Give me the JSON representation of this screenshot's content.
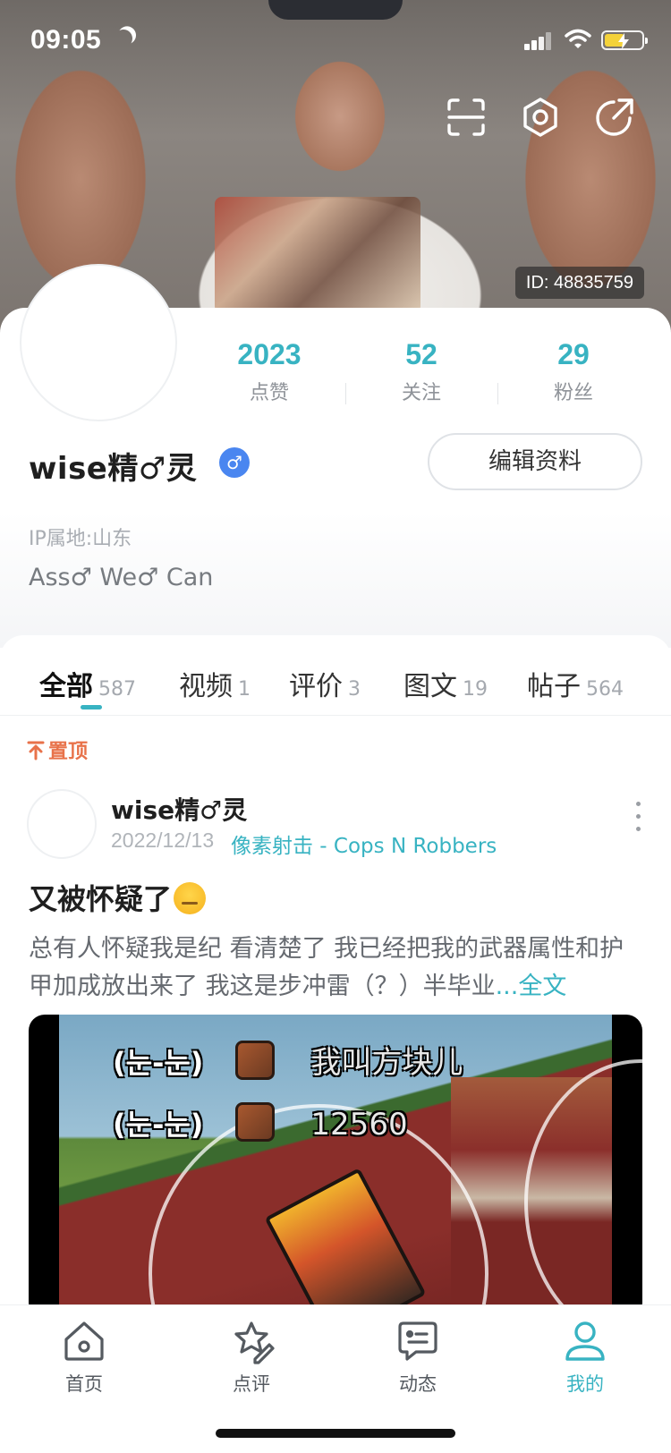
{
  "status_bar": {
    "time": "09:05",
    "icons": [
      "moon-icon",
      "signal-icon",
      "wifi-icon",
      "battery-charging-icon"
    ]
  },
  "header": {
    "actions": [
      "scan-icon",
      "settings-hexagon-icon",
      "share-icon"
    ],
    "id_text": "ID: 48835759"
  },
  "profile": {
    "stats": [
      {
        "value": "2023",
        "label": "点赞"
      },
      {
        "value": "52",
        "label": "关注"
      },
      {
        "value": "29",
        "label": "粉丝"
      }
    ],
    "username": "wise精♂灵",
    "verify_symbol": "♂",
    "edit_label": "编辑资料",
    "ip_location": "IP属地:山东",
    "bio": "Ass♂ We♂ Can"
  },
  "tabs": [
    {
      "label": "全部",
      "count": "587",
      "active": true
    },
    {
      "label": "视频",
      "count": "1"
    },
    {
      "label": "评价",
      "count": "3"
    },
    {
      "label": "图文",
      "count": "19"
    },
    {
      "label": "帖子",
      "count": "564"
    }
  ],
  "post": {
    "pinned_label": "置顶",
    "author": "wise精♂灵",
    "date": "2022/12/13",
    "game": "像素射击 - Cops N Robbers",
    "title": "又被怀疑了",
    "body": "总有人怀疑我是纪 看清楚了 我已经把我的武器属性和护甲加成放出来了 我这是步冲雷（？）半毕业",
    "read_more": "...全文",
    "image": {
      "rows": [
        {
          "tag": "(눈-눈)",
          "value": "我叫方块儿"
        },
        {
          "tag": "(눈-눈)",
          "value": "12560"
        }
      ]
    }
  },
  "bottom_nav": [
    {
      "label": "首页",
      "icon": "home-icon"
    },
    {
      "label": "点评",
      "icon": "review-pen-icon"
    },
    {
      "label": "动态",
      "icon": "message-icon"
    },
    {
      "label": "我的",
      "icon": "profile-icon",
      "active": true
    }
  ],
  "colors": {
    "accent": "#38b3c2",
    "pinned": "#e8724a",
    "verify_badge": "#4a86f0"
  }
}
